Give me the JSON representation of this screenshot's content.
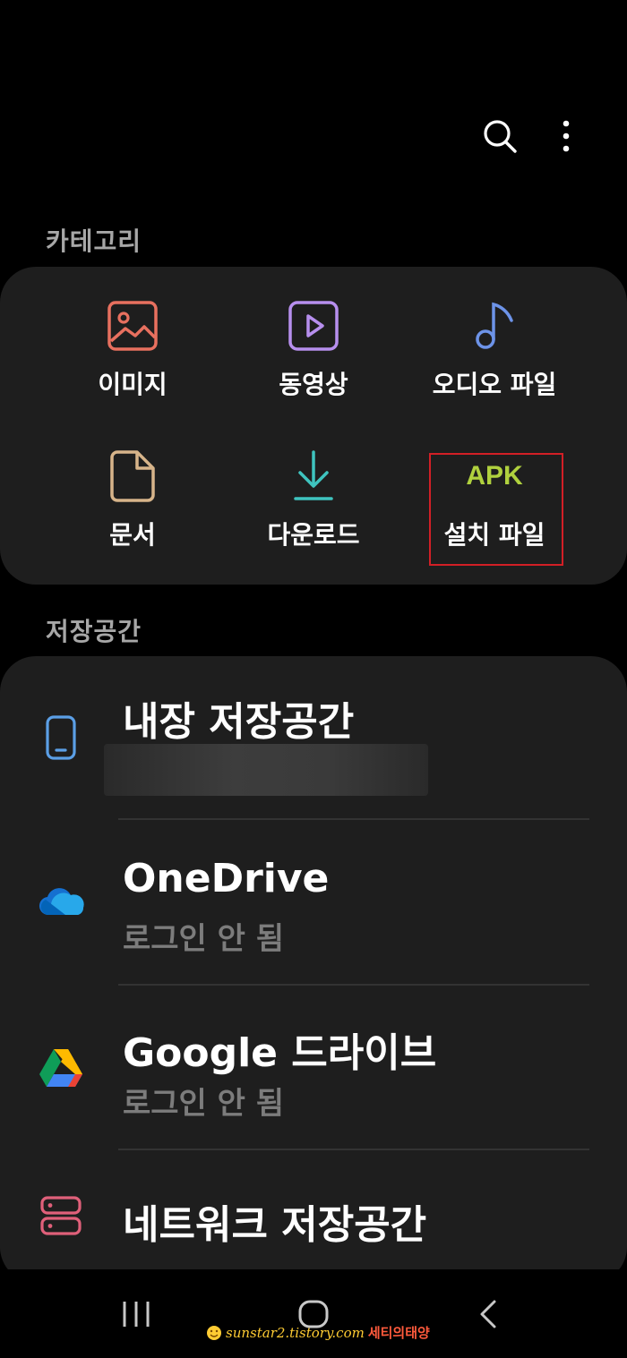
{
  "toolbar": {
    "search_icon": "search-icon",
    "more_icon": "more-vertical-icon"
  },
  "categories": {
    "title": "카테고리",
    "items": [
      {
        "label": "이미지",
        "icon": "image-icon",
        "color": "#e8705f"
      },
      {
        "label": "동영상",
        "icon": "video-icon",
        "color": "#b78fee"
      },
      {
        "label": "오디오 파일",
        "icon": "music-note-icon",
        "color": "#6d93e8"
      },
      {
        "label": "문서",
        "icon": "document-icon",
        "color": "#d7b48a"
      },
      {
        "label": "다운로드",
        "icon": "download-icon",
        "color": "#3fc4bf"
      },
      {
        "label": "설치 파일",
        "icon_text": "APK",
        "color": "#b0d13e"
      }
    ]
  },
  "storage": {
    "title": "저장공간",
    "items": [
      {
        "title": "내장 저장공간",
        "icon": "phone-icon",
        "color": "#5b9fe6"
      },
      {
        "title": "OneDrive",
        "subtitle": "로그인 안 됨",
        "icon": "onedrive-icon"
      },
      {
        "title": "Google 드라이브",
        "subtitle": "로그인 안 됨",
        "icon": "google-drive-icon"
      },
      {
        "title": "네트워크 저장공간",
        "icon": "network-storage-icon",
        "color": "#e0607a"
      }
    ]
  },
  "watermark": {
    "url": "sunstar2.tistory.com",
    "brand": "세티의태양"
  }
}
